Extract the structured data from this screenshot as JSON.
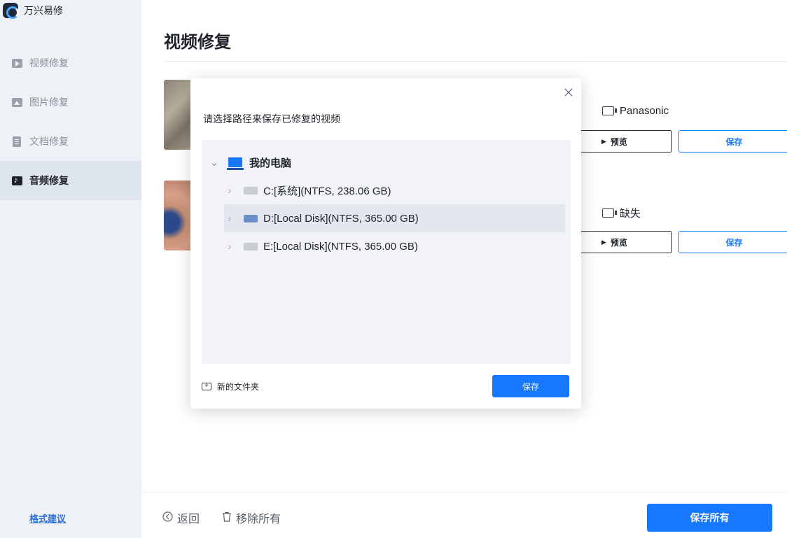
{
  "app": {
    "title": "万兴易修"
  },
  "titlebar": {
    "icons": [
      "user-icon",
      "headset-icon",
      "mail-icon",
      "menu-icon",
      "minimize-icon",
      "close-icon"
    ]
  },
  "sidebar": {
    "items": [
      {
        "label": "视频修复",
        "icon": "video-icon"
      },
      {
        "label": "图片修复",
        "icon": "image-icon"
      },
      {
        "label": "文档修复",
        "icon": "document-icon"
      },
      {
        "label": "音频修复",
        "icon": "audio-icon",
        "active": true
      }
    ],
    "format_link": "格式建议"
  },
  "main": {
    "title": "视频修复",
    "cards": [
      {
        "device": "Panasonic",
        "preview_label": "预览",
        "save_label": "保存"
      },
      {
        "device": "缺失",
        "preview_label": "预览",
        "save_label": "保存"
      }
    ]
  },
  "footer": {
    "back_label": "返回",
    "remove_all_label": "移除所有",
    "save_all_label": "保存所有"
  },
  "dialog": {
    "title": "请选择路径来保存已修复的视频",
    "tree": {
      "root": "我的电脑",
      "drives": [
        {
          "label": "C:[系统](NTFS, 238.06  GB)"
        },
        {
          "label": "D:[Local Disk](NTFS, 365.00  GB)",
          "selected": true
        },
        {
          "label": "E:[Local Disk](NTFS, 365.00  GB)"
        }
      ]
    },
    "new_folder_label": "新的文件夹",
    "save_label": "保存"
  },
  "colors": {
    "accent": "#1677ff",
    "sidebar_bg": "#eef1f6",
    "sidebar_active": "#dfe5ee"
  }
}
